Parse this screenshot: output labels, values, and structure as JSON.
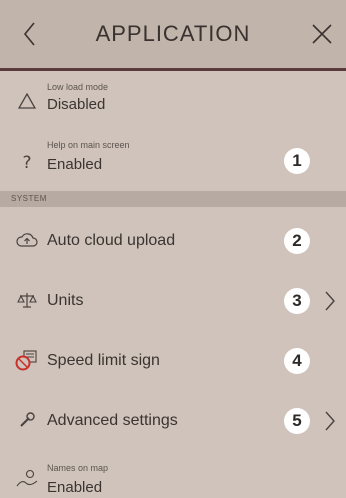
{
  "header": {
    "title": "APPLICATION",
    "back_icon": "chevron-left-icon",
    "close_icon": "close-icon"
  },
  "settings": {
    "low_load": {
      "sublabel": "Low load mode",
      "value": "Disabled",
      "icon": "warning-triangle-icon"
    },
    "help": {
      "sublabel": "Help on main screen",
      "value": "Enabled",
      "icon": "question-icon",
      "badge": "1"
    }
  },
  "system": {
    "section_label": "SYSTEM",
    "items": [
      {
        "label": "Auto cloud upload",
        "icon": "cloud-upload-icon",
        "badge": "2"
      },
      {
        "label": "Units",
        "icon": "scale-icon",
        "badge": "3"
      },
      {
        "label": "Speed limit sign",
        "icon": "speed-limit-sign-icon",
        "badge": "4"
      },
      {
        "label": "Advanced settings",
        "icon": "wrench-icon",
        "badge": "5"
      }
    ],
    "names_on_map": {
      "sublabel": "Names on map",
      "value": "Enabled",
      "icon": "map-pin-icon"
    }
  },
  "colors": {
    "background": "#cfc3bb",
    "header": "#c1b4ab",
    "header_rule": "#5a3a3c",
    "speed_sign_red": "#c8302b",
    "badge_bg": "#ffffff"
  }
}
